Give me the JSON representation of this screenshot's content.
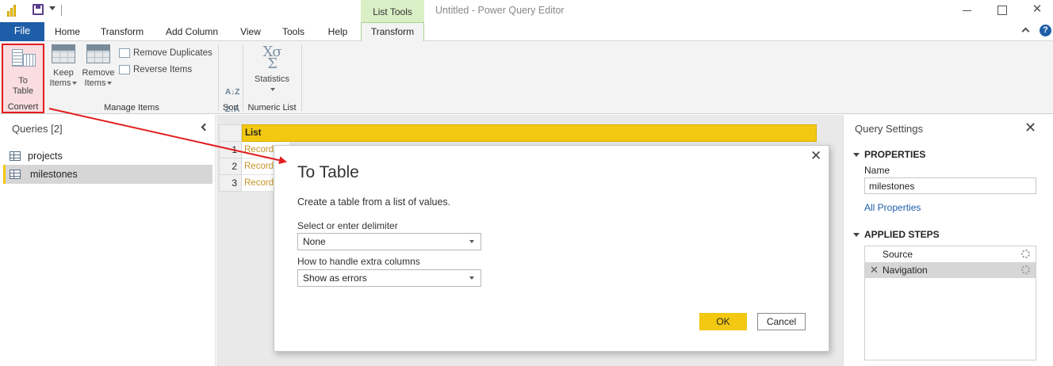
{
  "titlebar": {
    "context_tab": "List Tools",
    "window_title": "Untitled - Power Query Editor"
  },
  "tabs": {
    "file": "File",
    "items": [
      "Home",
      "Transform",
      "Add Column",
      "View",
      "Tools",
      "Help",
      "Transform"
    ],
    "active_index": 6,
    "help_glyph": "?"
  },
  "ribbon": {
    "convert": {
      "button_line1": "To",
      "button_line2": "Table",
      "group_label": "Convert"
    },
    "manage_items": {
      "keep_line1": "Keep",
      "keep_line2": "Items",
      "remove_line1": "Remove",
      "remove_line2": "Items",
      "remove_duplicates": "Remove Duplicates",
      "reverse_items": "Reverse Items",
      "group_label": "Manage Items"
    },
    "sort": {
      "group_label": "Sort",
      "asc_glyph": "A↓Z",
      "desc_glyph": "Z↓A"
    },
    "numeric_list": {
      "statistics": "Statistics",
      "stat_glyph": "Χσ Σ",
      "group_label": "Numeric List"
    }
  },
  "queries": {
    "title": "Queries [2]",
    "items": [
      {
        "name": "projects",
        "selected": false
      },
      {
        "name": "milestones",
        "selected": true
      }
    ]
  },
  "grid": {
    "header": "List",
    "rows": [
      {
        "num": "1",
        "value": "Record"
      },
      {
        "num": "2",
        "value": "Record"
      },
      {
        "num": "3",
        "value": "Record"
      }
    ]
  },
  "settings": {
    "title": "Query Settings",
    "properties_head": "PROPERTIES",
    "name_label": "Name",
    "name_value": "milestones",
    "all_properties": "All Properties",
    "steps_head": "APPLIED STEPS",
    "steps": [
      {
        "name": "Source",
        "selected": false
      },
      {
        "name": "Navigation",
        "selected": true
      }
    ]
  },
  "dialog": {
    "title": "To Table",
    "description": "Create a table from a list of values.",
    "delimiter_label": "Select or enter delimiter",
    "delimiter_value": "None",
    "extra_columns_label": "How to handle extra columns",
    "extra_columns_value": "Show as errors",
    "ok": "OK",
    "cancel": "Cancel"
  },
  "colors": {
    "accent_yellow": "#f2c811",
    "file_blue": "#1e5ea8",
    "annotation_red": "#e31e1e",
    "record_text": "#c6952a"
  }
}
